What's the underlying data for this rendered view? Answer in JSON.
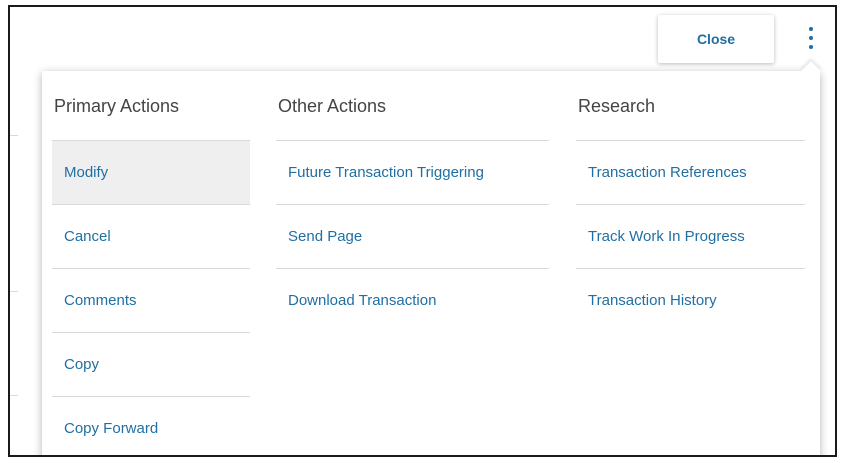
{
  "header": {
    "close_label": "Close"
  },
  "menu": {
    "columns": [
      {
        "title": "Primary Actions",
        "items": [
          "Modify",
          "Cancel",
          "Comments",
          "Copy",
          "Copy Forward"
        ]
      },
      {
        "title": "Other Actions",
        "items": [
          "Future Transaction Triggering",
          "Send Page",
          "Download Transaction"
        ]
      },
      {
        "title": "Research",
        "items": [
          "Transaction References",
          "Track Work In Progress",
          "Transaction History"
        ]
      }
    ]
  },
  "colors": {
    "link": "#1f6fa3",
    "header_text": "#444444",
    "divider": "#d9d9d9",
    "highlight": "#efefef"
  },
  "icons": {
    "more": "more-vertical-icon"
  }
}
